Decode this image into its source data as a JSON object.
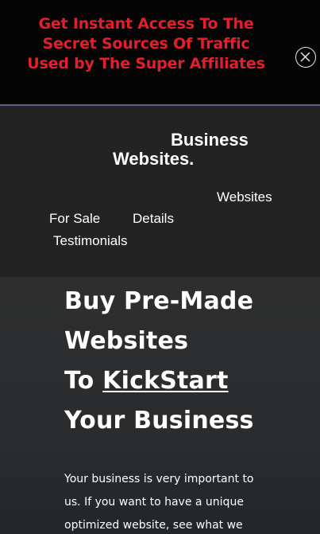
{
  "promo": {
    "lines": [
      "Get Instant Access To The",
      "Secret Sources Of Traffic",
      "Used by The Super Affiliates"
    ],
    "close_icon": "close-circle-icon",
    "text_color": "#e21f2a"
  },
  "brand": {
    "line1": "Business",
    "line2": "Websites."
  },
  "nav": {
    "websites": "Websites",
    "for_sale": "For Sale",
    "details": "Details",
    "testimonials": "Testimonials"
  },
  "hero": {
    "title_line1": "Buy Pre-Made",
    "title_line2": "Websites",
    "title_line3_prefix": "To ",
    "title_line3_link": "KickStart",
    "title_line4": "Your Business",
    "desc_lines": [
      "Your business is very important to",
      "us. If you want to have a unique",
      "optimized website, see what we"
    ]
  }
}
